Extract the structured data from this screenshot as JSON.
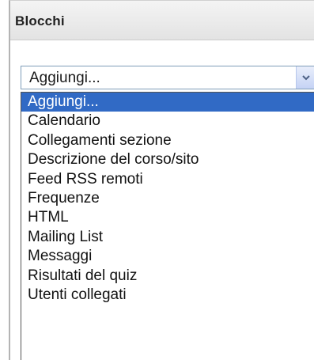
{
  "block": {
    "title": "Blocchi"
  },
  "add_select": {
    "value": "Aggiungi...",
    "arrow_icon": "chevron-down-icon"
  },
  "dropdown": {
    "selected_index": 0,
    "highlight_color": "#316ac5",
    "options": [
      "Aggiungi...",
      "Calendario",
      "Collegamenti sezione",
      "Descrizione del corso/sito",
      "Feed RSS remoti",
      "Frequenze",
      "HTML",
      "Mailing List",
      "Messaggi",
      "Risultati del quiz",
      "Utenti collegati"
    ]
  }
}
